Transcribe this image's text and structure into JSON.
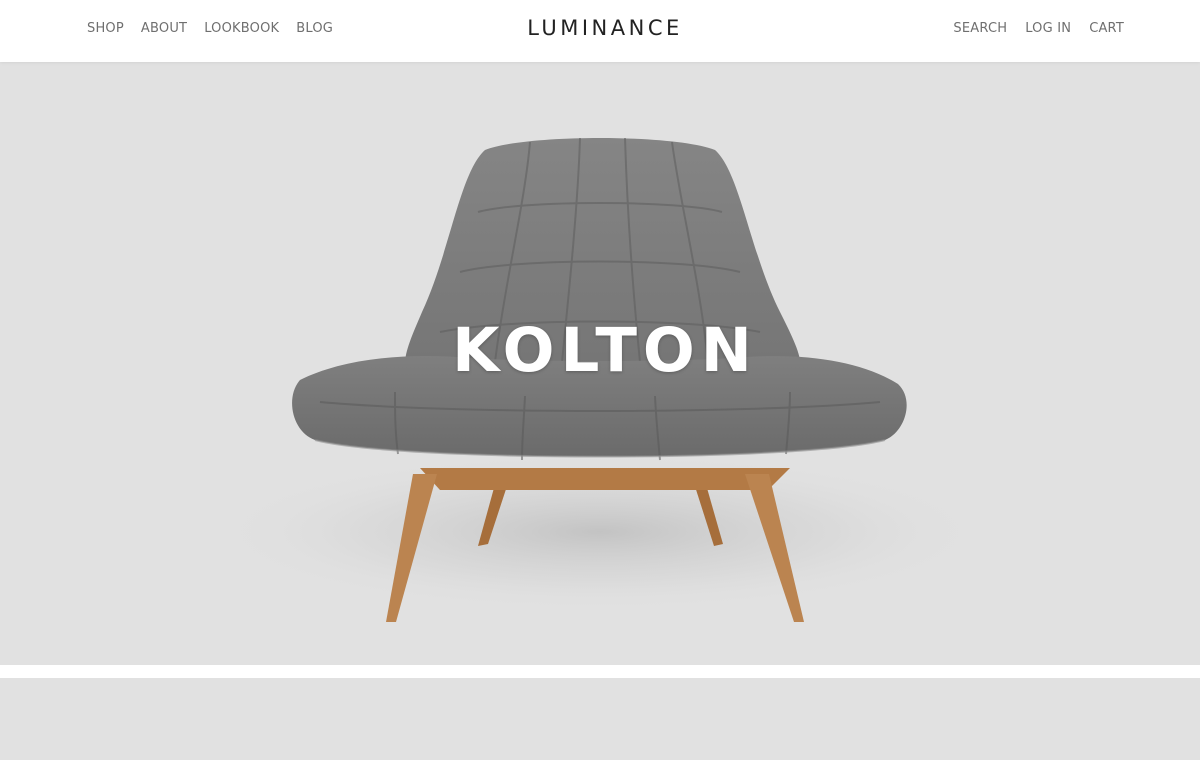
{
  "header": {
    "brand": "LUMINANCE",
    "nav_left": [
      "SHOP",
      "ABOUT",
      "LOOKBOOK",
      "BLOG"
    ],
    "nav_right": [
      "SEARCH",
      "LOG IN",
      "CART"
    ]
  },
  "hero": {
    "title": "KOLTON",
    "image_subject": "grey tufted lounge chair with oak legs"
  },
  "colors": {
    "hero_background": "#e1e1e1",
    "upholstery": "#7b7b7b",
    "wood": "#b37a45",
    "nav_text": "#6f6f6f",
    "brand_text": "#222222",
    "title_text": "#ffffff"
  }
}
